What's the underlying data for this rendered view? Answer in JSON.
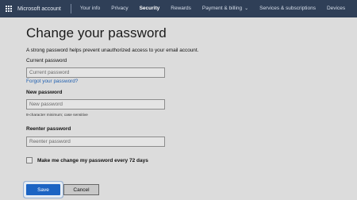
{
  "nav": {
    "brand": "Microsoft account",
    "items": [
      {
        "label": "Your info",
        "active": false
      },
      {
        "label": "Privacy",
        "active": false
      },
      {
        "label": "Security",
        "active": true
      },
      {
        "label": "Rewards",
        "active": false
      },
      {
        "label": "Payment & billing",
        "active": false,
        "has_dropdown": true
      },
      {
        "label": "Services & subscriptions",
        "active": false
      },
      {
        "label": "Devices",
        "active": false
      }
    ],
    "background_color": "#2f3f57"
  },
  "page": {
    "title": "Change your password",
    "hint": "A strong password helps prevent unauthorized access to your email account.",
    "current_label": "Current password",
    "current_placeholder": "Current password",
    "forgot_link": "Forgot your password?",
    "new_label": "New password",
    "new_placeholder": "New password",
    "new_helper": "8-character minimum; case sensitive",
    "reenter_label": "Reenter password",
    "reenter_placeholder": "Reenter password",
    "checkbox_label": "Make me change my password every 72 days",
    "checkbox_checked": false
  },
  "actions": {
    "save": "Save",
    "cancel": "Cancel",
    "save_color": "#1c64c3"
  }
}
